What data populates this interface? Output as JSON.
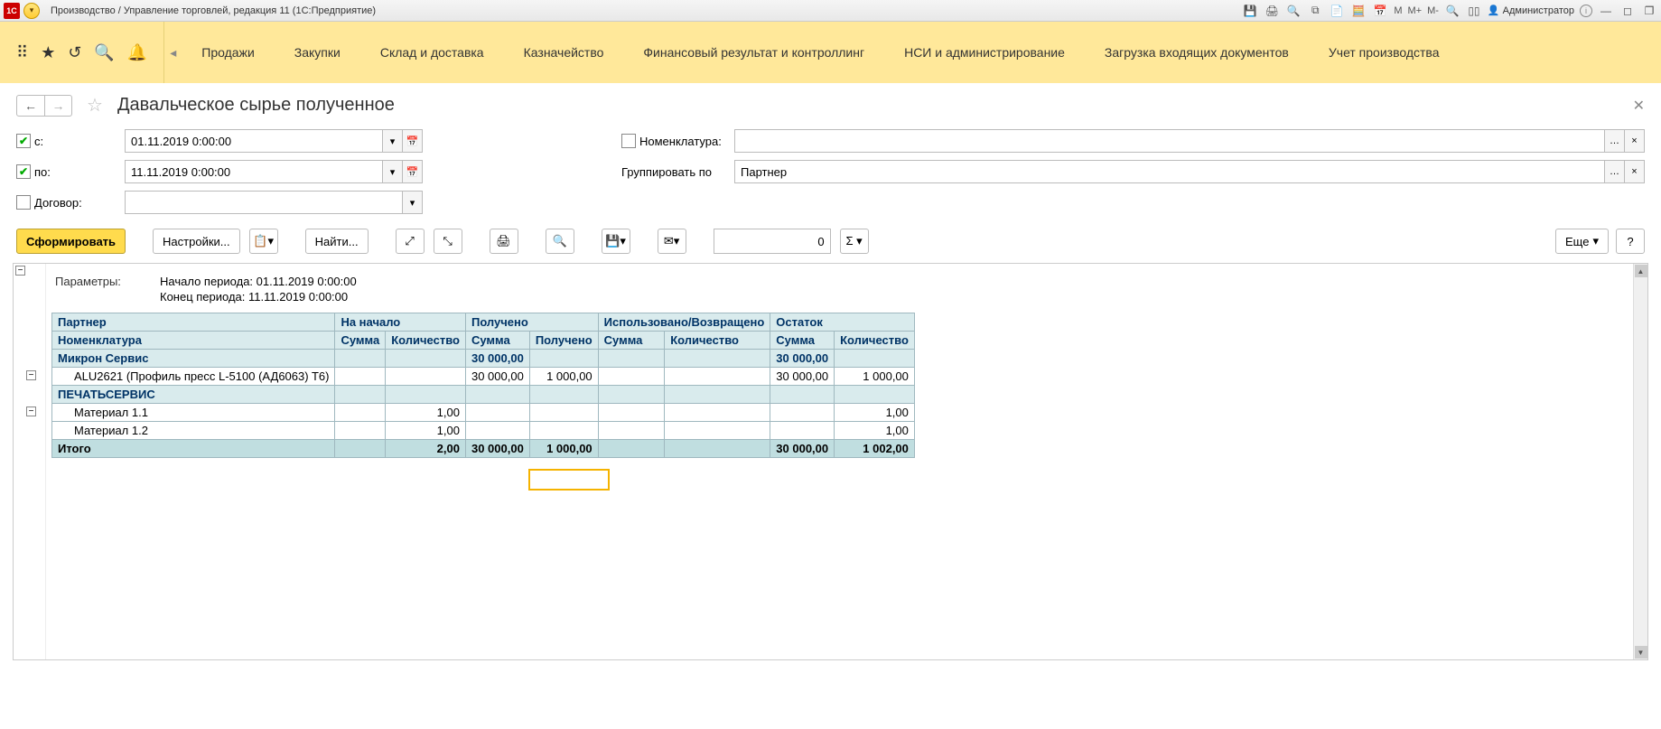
{
  "titlebar": {
    "logo": "1C",
    "title": "Производство / Управление торговлей, редакция 11  (1С:Предприятие)",
    "m1": "M",
    "m2": "M+",
    "m3": "M-",
    "admin": "Администратор"
  },
  "menu": {
    "items": [
      "Продажи",
      "Закупки",
      "Склад и доставка",
      "Казначейство",
      "Финансовый результат и контроллинг",
      "НСИ и администрирование",
      "Загрузка входящих документов",
      "Учет производства"
    ]
  },
  "page": {
    "title": "Давальческое сырье полученное"
  },
  "filters": {
    "from_label": "с:",
    "from_value": "01.11.2019  0:00:00",
    "to_label": "по:",
    "to_value": "11.11.2019  0:00:00",
    "contract_label": "Договор:",
    "nomen_label": "Номенклатура:",
    "group_label": "Группировать по",
    "group_value": "Партнер"
  },
  "toolbar": {
    "form": "Сформировать",
    "settings": "Настройки...",
    "find": "Найти...",
    "num_value": "0",
    "more": "Еще",
    "help": "?"
  },
  "report": {
    "params_label": "Параметры:",
    "param_start": "Начало периода: 01.11.2019 0:00:00",
    "param_end": "Конец периода: 11.11.2019 0:00:00",
    "headers1": [
      "Партнер",
      "На начало",
      "Получено",
      "Использовано/Возвращено",
      "Остаток"
    ],
    "headers2": [
      "Номенклатура",
      "Сумма",
      "Количество",
      "Сумма",
      "Получено",
      "Сумма",
      "Количество",
      "Сумма",
      "Количество"
    ],
    "groups": [
      {
        "name": "Микрон Сервис",
        "sums": [
          "",
          "",
          "30 000,00",
          "",
          "",
          "",
          "30 000,00",
          ""
        ],
        "rows": [
          {
            "name": "ALU2621 (Профиль пресс L-5100 (АД6063) T6)",
            "vals": [
              "",
              "",
              "30 000,00",
              "1 000,00",
              "",
              "",
              "30 000,00",
              "1 000,00"
            ]
          }
        ]
      },
      {
        "name": "ПЕЧАТЬСЕРВИС",
        "sums": [
          "",
          "",
          "",
          "",
          "",
          "",
          "",
          ""
        ],
        "rows": [
          {
            "name": "Материал 1.1",
            "vals": [
              "",
              "1,00",
              "",
              "",
              "",
              "",
              "",
              "1,00"
            ]
          },
          {
            "name": "Материал 1.2",
            "vals": [
              "",
              "1,00",
              "",
              "",
              "",
              "",
              "",
              "1,00"
            ]
          }
        ]
      }
    ],
    "total_label": "Итого",
    "total_vals": [
      "",
      "2,00",
      "30 000,00",
      "1 000,00",
      "",
      "",
      "30 000,00",
      "1 002,00"
    ]
  }
}
